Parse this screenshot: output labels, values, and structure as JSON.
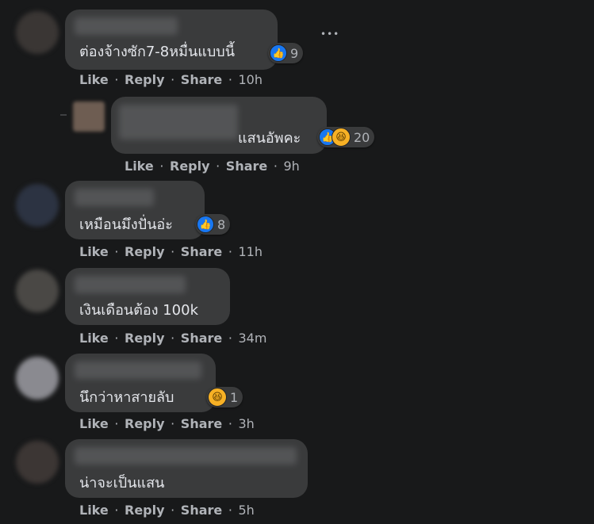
{
  "actions": {
    "like": "Like",
    "reply": "Reply",
    "share": "Share",
    "sep": "·"
  },
  "more_label": "•••",
  "comments": [
    {
      "text": "ต่องจ้างซัก7-8หมื่นแบบนี้",
      "reactions": "like",
      "count": "9",
      "time": "10h"
    },
    {
      "text": "แสนอัพคะ",
      "reactions": "like+haha",
      "count": "20",
      "time": "9h"
    },
    {
      "text": "เหมือนมึงปั่นอ่ะ",
      "reactions": "like",
      "count": "8",
      "time": "11h"
    },
    {
      "text": "เงินเดือนต้อง 100k",
      "reactions": "",
      "count": "",
      "time": "34m"
    },
    {
      "text": "นึกว่าหาสายลับ",
      "reactions": "haha",
      "count": "1",
      "time": "3h"
    },
    {
      "text": "น่าจะเป็นแสน",
      "reactions": "",
      "count": "",
      "time": "5h"
    }
  ],
  "icons": {
    "like": "thumbs-up-icon",
    "haha": "haha-emoji-icon"
  },
  "colors": {
    "background": "#18191a",
    "bubble": "#3a3b3c",
    "like_blue": "#1877f2",
    "haha_yellow": "#f7b125",
    "meta_text": "#b0b3b8"
  }
}
